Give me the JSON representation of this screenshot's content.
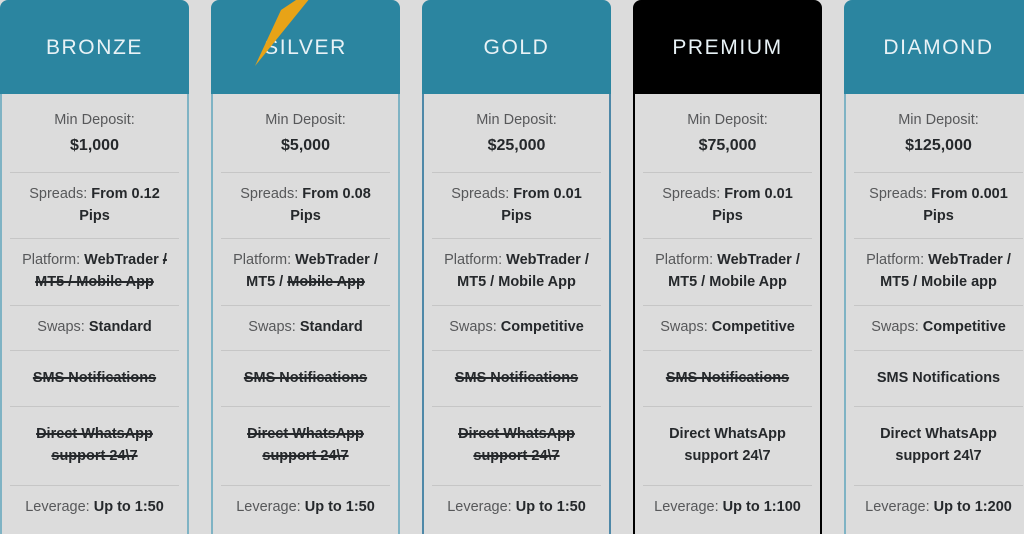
{
  "page": {
    "background_color": "#dcdcdc",
    "accent_color": "#2b85a0",
    "premium_color": "#000000",
    "bolt_color": "#e8a317"
  },
  "row_labels": {
    "min_deposit": "Min Deposit:",
    "spreads": "Spreads:",
    "platform": "Platform:",
    "swaps": "Swaps:",
    "leverage": "Leverage:"
  },
  "plans": [
    {
      "name": "BRONZE",
      "header_color": "#2b85a0",
      "border_color": "#7fb3c4",
      "min_deposit": "$1,000",
      "spreads_value": "From 0.12 Pips",
      "platform_plain": "WebTrader",
      "platform_struck": "/ MT5 / Mobile App",
      "platform_full": "WebTrader / MT5 / Mobile App",
      "swaps": "Standard",
      "sms": "SMS Notifications",
      "sms_struck": true,
      "whatsapp": "Direct WhatsApp support 24\\7",
      "whatsapp_struck": true,
      "leverage": "Up to 1:50",
      "has_bolt": false
    },
    {
      "name": "SILVER",
      "header_color": "#2b85a0",
      "border_color": "#7fb3c4",
      "min_deposit": "$5,000",
      "spreads_value": "From 0.08 Pips",
      "platform_plain": "WebTrader / MT5 /",
      "platform_struck": "Mobile App",
      "platform_full": "WebTrader / MT5 / Mobile App",
      "swaps": "Standard",
      "sms": "SMS Notifications",
      "sms_struck": true,
      "whatsapp": "Direct WhatsApp support 24\\7",
      "whatsapp_struck": true,
      "leverage": "Up to 1:50",
      "has_bolt": true
    },
    {
      "name": "GOLD",
      "header_color": "#2b85a0",
      "border_color": "#4e88a8",
      "min_deposit": "$25,000",
      "spreads_value": "From 0.01 Pips",
      "platform_plain": "WebTrader / MT5 / Mobile App",
      "platform_struck": "",
      "platform_full": "WebTrader / MT5 / Mobile App",
      "swaps": "Competitive",
      "sms": "SMS Notifications",
      "sms_struck": true,
      "whatsapp": "Direct WhatsApp support 24\\7",
      "whatsapp_struck": true,
      "leverage": "Up to 1:50",
      "has_bolt": false
    },
    {
      "name": "PREMIUM",
      "header_color": "#000000",
      "border_color": "#000000",
      "min_deposit": "$75,000",
      "spreads_value": "From 0.01 Pips",
      "platform_plain": "WebTrader / MT5 / Mobile App",
      "platform_struck": "",
      "platform_full": "WebTrader / MT5 / Mobile App",
      "swaps": "Competitive",
      "sms": "SMS Notifications",
      "sms_struck": true,
      "whatsapp": "Direct WhatsApp support 24\\7",
      "whatsapp_struck": false,
      "leverage": "Up to 1:100",
      "has_bolt": false
    },
    {
      "name": "DIAMOND",
      "header_color": "#2b85a0",
      "border_color": "#7fb3c4",
      "min_deposit": "$125,000",
      "spreads_value": "From 0.001 Pips",
      "platform_plain": "WebTrader / MT5 / Mobile app",
      "platform_struck": "",
      "platform_full": "WebTrader / MT5 / Mobile app",
      "swaps": "Competitive",
      "sms": "SMS Notifications",
      "sms_struck": false,
      "whatsapp": "Direct WhatsApp support 24\\7",
      "whatsapp_struck": false,
      "leverage": "Up to 1:200",
      "has_bolt": false
    }
  ]
}
